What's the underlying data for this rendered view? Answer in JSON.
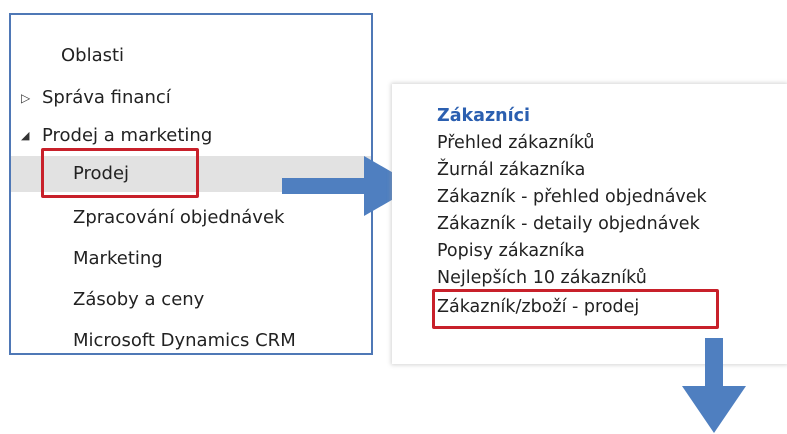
{
  "navigation": {
    "items": [
      {
        "label": "Oblasti",
        "indent": 0,
        "toggle": ""
      },
      {
        "label": "Správa financí",
        "indent": 0,
        "toggle": "collapsed"
      },
      {
        "label": "Prodej a marketing",
        "indent": 0,
        "toggle": "expanded"
      },
      {
        "label": "Prodej",
        "indent": 1,
        "toggle": "",
        "selected": true
      },
      {
        "label": "Zpracování objednávek",
        "indent": 1,
        "toggle": ""
      },
      {
        "label": "Marketing",
        "indent": 1,
        "toggle": ""
      },
      {
        "label": "Zásoby a ceny",
        "indent": 1,
        "toggle": ""
      },
      {
        "label": "Microsoft Dynamics CRM",
        "indent": 1,
        "toggle": ""
      }
    ],
    "toggle_glyphs": {
      "collapsed": "▷",
      "expanded": "◢"
    }
  },
  "customers_menu": {
    "title": "Zákazníci",
    "items": [
      "Přehled zákazníků",
      "Žurnál zákazníka",
      "Zákazník - přehled objednávek",
      "Zákazník - detaily objednávek",
      "Popisy zákazníka",
      "Nejlepších 10 zákazníků",
      "Zákazník/zboží - prodej"
    ],
    "highlighted_index": 5
  },
  "colors": {
    "pane_border": "#4f78b6",
    "highlight": "#c8202a",
    "title": "#2b5fb0",
    "arrow": "#4f7fc0",
    "selected_bg": "#e2e2e2"
  }
}
